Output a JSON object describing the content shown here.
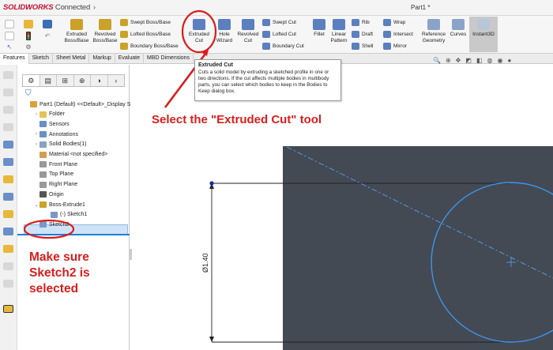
{
  "app": {
    "logo_brand": "SOLIDWORKS",
    "logo_suffix": "Connected",
    "document_title": "Part1 *",
    "arrow": "›"
  },
  "ribbon": {
    "tools": [
      {
        "label1": "Extruded",
        "label2": "Boss/Base",
        "icon": "extruded-boss-icon",
        "color": "#c9a227"
      },
      {
        "label1": "Revolved",
        "label2": "Boss/Base",
        "icon": "revolved-boss-icon",
        "color": "#c9a227"
      },
      {
        "label1": "Extruded",
        "label2": "Cut",
        "icon": "extruded-cut-icon",
        "color": "#5b7fbf"
      },
      {
        "label1": "Hole",
        "label2": "Wizard",
        "icon": "hole-wizard-icon",
        "color": "#5b7fbf"
      },
      {
        "label1": "Revolved",
        "label2": "Cut",
        "icon": "revolved-cut-icon",
        "color": "#5b7fbf"
      },
      {
        "label1": "Fillet",
        "label2": "",
        "icon": "fillet-icon",
        "color": "#5b7fbf"
      },
      {
        "label1": "Linear",
        "label2": "Pattern",
        "icon": "linear-pattern-icon",
        "color": "#5b7fbf"
      },
      {
        "label1": "Reference",
        "label2": "Geometry",
        "icon": "reference-geometry-icon",
        "color": "#8aa4c8"
      },
      {
        "label1": "Curves",
        "label2": "",
        "icon": "curves-icon",
        "color": "#8aa4c8"
      },
      {
        "label1": "Instant3D",
        "label2": "",
        "icon": "instant3d-icon",
        "color": "#b8c7d8"
      }
    ],
    "row_tools": [
      {
        "label": "Swept Boss/Base",
        "color": "#c9a227"
      },
      {
        "label": "Lofted Boss/Base",
        "color": "#c9a227"
      },
      {
        "label": "Boundary Boss/Base",
        "color": "#c9a227"
      },
      {
        "label": "Swept Cut",
        "color": "#5b7fbf"
      },
      {
        "label": "Lofted Cut",
        "color": "#5b7fbf"
      },
      {
        "label": "Boundary Cut",
        "color": "#5b7fbf"
      },
      {
        "label": "Rib",
        "color": "#5b7fbf"
      },
      {
        "label": "Draft",
        "color": "#5b7fbf"
      },
      {
        "label": "Shell",
        "color": "#5b7fbf"
      },
      {
        "label": "Wrap",
        "color": "#5b7fbf"
      },
      {
        "label": "Intersect",
        "color": "#5b7fbf"
      },
      {
        "label": "Mirror",
        "color": "#5b7fbf"
      }
    ]
  },
  "tabs": [
    "Features",
    "Sketch",
    "Sheet Metal",
    "Markup",
    "Evaluate",
    "MBD Dimensions"
  ],
  "tooltip": {
    "title": "Extruded Cut",
    "body": "Cuts a solid model by extruding a sketched profile in one or two directions. If the cut affects multiple bodies in multibody parts, you can select which bodies to keep in the Bodies to Keep dialog box."
  },
  "tree": [
    {
      "label": "Part1 (Default) <<Default>_Display St",
      "expander": "",
      "color": "#d9a13b",
      "indent": 0
    },
    {
      "label": "Folder",
      "expander": "›",
      "color": "#e6c25a",
      "indent": 12
    },
    {
      "label": "Sensors",
      "expander": "",
      "color": "#6a8fc4",
      "indent": 12
    },
    {
      "label": "Annotations",
      "expander": "›",
      "color": "#6a8fc4",
      "indent": 12
    },
    {
      "label": "Solid Bodies(1)",
      "expander": "›",
      "color": "#8aa2c0",
      "indent": 12
    },
    {
      "label": "Material <not specified>",
      "expander": "",
      "color": "#d0a050",
      "indent": 12
    },
    {
      "label": "Front Plane",
      "expander": "",
      "color": "#999999",
      "indent": 12
    },
    {
      "label": "Top Plane",
      "expander": "",
      "color": "#999999",
      "indent": 12
    },
    {
      "label": "Right Plane",
      "expander": "",
      "color": "#999999",
      "indent": 12
    },
    {
      "label": "Origin",
      "expander": "",
      "color": "#555555",
      "indent": 12
    },
    {
      "label": "Boss-Extrude1",
      "expander": "⌄",
      "color": "#c9a227",
      "indent": 12
    },
    {
      "label": "(-) Sketch1",
      "expander": "",
      "color": "#7a98c8",
      "indent": 26
    },
    {
      "label": "Sketch2",
      "expander": "",
      "color": "#7a98c8",
      "indent": 12
    }
  ],
  "annotations": {
    "select_tool": "Select the \"Extruded Cut\" tool",
    "make_sure": [
      "Make sure",
      "Sketch2 is",
      "selected"
    ]
  },
  "sketch": {
    "dimension_label": "Ø1.40"
  },
  "colors": {
    "annotation_red": "#d81e1e",
    "sketch_blue": "#3f93e8",
    "viewport_dark": "#434a54"
  }
}
